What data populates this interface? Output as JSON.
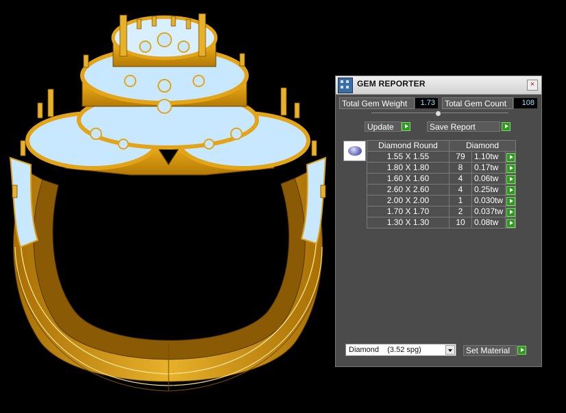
{
  "panel": {
    "title": "GEM REPORTER",
    "close_glyph": "×",
    "total_gem_weight_label": "Total Gem Weight",
    "total_gem_weight_value": "1.73",
    "total_gem_count_label": "Total Gem Count",
    "total_gem_count_value": "108",
    "update_label": "Update",
    "save_report_label": "Save Report",
    "table": {
      "header_shape": "Diamond Round",
      "header_material": "Diamond",
      "rows": [
        {
          "size": "1.55 X 1.55",
          "count": "79",
          "weight": "1.10tw"
        },
        {
          "size": "1.80 X 1.80",
          "count": "8",
          "weight": "0.17tw"
        },
        {
          "size": "1.60 X 1.60",
          "count": "4",
          "weight": "0.06tw"
        },
        {
          "size": "2.60 X 2.60",
          "count": "4",
          "weight": "0.25tw"
        },
        {
          "size": "2.00 X 2.00",
          "count": "1",
          "weight": "0.030tw"
        },
        {
          "size": "1.70 X 1.70",
          "count": "2",
          "weight": "0.037tw"
        },
        {
          "size": "1.30 X 1.30",
          "count": "10",
          "weight": "0.08tw"
        }
      ]
    },
    "material_select_value": "Diamond    (3.52 spg)",
    "set_material_label": "Set Material",
    "icons": {
      "app": "gem-reporter-app-icon",
      "close": "close-icon",
      "run": "green-play-icon",
      "gem": "oval-gem-icon",
      "dropdown": "chevron-down-icon"
    },
    "colors": {
      "panel_bg": "#4b4b4b",
      "play_green": "#2e9a1e",
      "value_text": "#9ae6ff",
      "gold": "#e3a417",
      "gem_blue": "#c8e8ff"
    }
  }
}
